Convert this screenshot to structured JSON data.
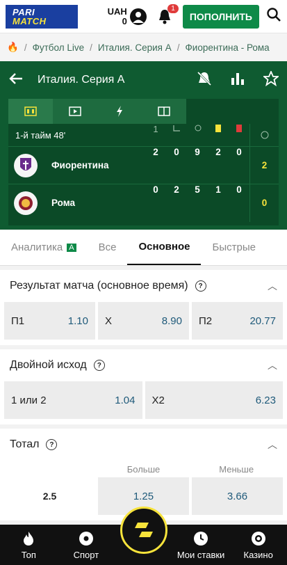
{
  "header": {
    "logo_top": "PARI",
    "logo_bottom": "MATCH",
    "currency": "UAH",
    "balance": "0",
    "notif_count": "1",
    "deposit_label": "ПОПОЛНИТЬ"
  },
  "breadcrumb": [
    "Футбол Live",
    "Италия. Серия A",
    "Фиорентина - Рома"
  ],
  "event": {
    "title": "Италия. Серия A",
    "period": "1-й тайм 48'"
  },
  "score_cols": [
    "1"
  ],
  "teams": [
    {
      "name": "Фиорентина",
      "stats": [
        "2",
        "0",
        "9",
        "2",
        "0"
      ],
      "score": "2"
    },
    {
      "name": "Рома",
      "stats": [
        "0",
        "2",
        "5",
        "1",
        "0"
      ],
      "score": "0"
    }
  ],
  "tabs": [
    "Аналитика",
    "Все",
    "Основное",
    "Быстрые"
  ],
  "tab_badge": "A",
  "markets": {
    "result": {
      "title": "Результат матча (основное время)",
      "odds": [
        {
          "label": "П1",
          "value": "1.10"
        },
        {
          "label": "X",
          "value": "8.90"
        },
        {
          "label": "П2",
          "value": "20.77"
        }
      ]
    },
    "double": {
      "title": "Двойной исход",
      "odds": [
        {
          "label": "1 или 2",
          "value": "1.04"
        },
        {
          "label": "X2",
          "value": "6.23"
        }
      ]
    },
    "total": {
      "title": "Тотал",
      "over": "Больше",
      "under": "Меньше",
      "line": "2.5",
      "over_value": "1.25",
      "under_value": "3.66"
    }
  },
  "nav": [
    "Топ",
    "Спорт",
    "Мои ставки",
    "Казино"
  ]
}
